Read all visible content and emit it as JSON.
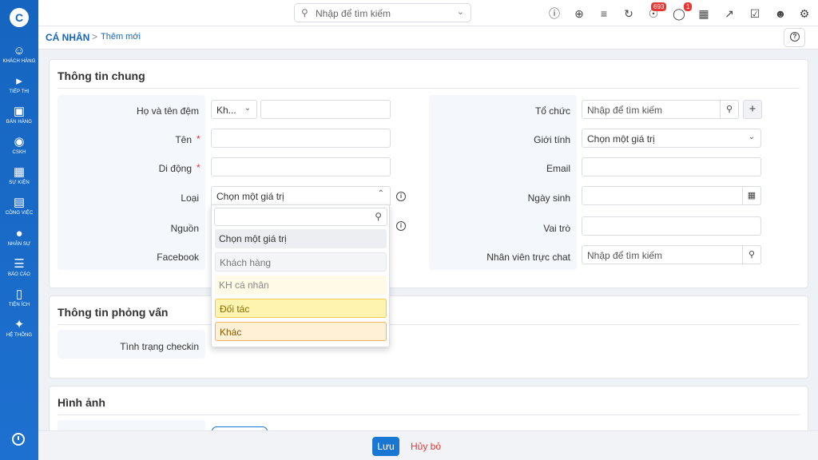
{
  "top": {
    "search_placeholder": "Nhập để tìm kiếm",
    "notif_count": "693",
    "chat_count": "1"
  },
  "sidebar": {
    "items": [
      {
        "label": "KHÁCH HÀNG",
        "icon": "customers-icon"
      },
      {
        "label": "TIẾP THỊ",
        "icon": "megaphone-icon"
      },
      {
        "label": "BÁN HÀNG",
        "icon": "cart-icon"
      },
      {
        "label": "CSKH",
        "icon": "lifebuoy-icon"
      },
      {
        "label": "SỰ KIỆN",
        "icon": "calendar-icon"
      },
      {
        "label": "CÔNG VIỆC",
        "icon": "briefcase-icon"
      },
      {
        "label": "NHÂN SỰ",
        "icon": "person-icon"
      },
      {
        "label": "BÁO CÁO",
        "icon": "report-icon"
      },
      {
        "label": "TIỆN ÍCH",
        "icon": "utilities-icon"
      },
      {
        "label": "HỆ THỐNG",
        "icon": "wrench-icon"
      }
    ]
  },
  "breadcrumb": {
    "root": "CÁ NHÂN",
    "separator": ">",
    "current": "Thêm mới"
  },
  "general": {
    "title": "Thông tin chung",
    "fullname_label": "Họ và tên đệm",
    "title_select": "Kh...",
    "name_label": "Tên",
    "mobile_label": "Di động",
    "type_label": "Loại",
    "type_value": "Chọn một giá trị",
    "source_label": "Nguồn",
    "facebook_label": "Facebook",
    "org_label": "Tổ chức",
    "org_placeholder": "Nhập để tìm kiếm",
    "gender_label": "Giới tính",
    "gender_value": "Chọn một giá trị",
    "email_label": "Email",
    "birthday_label": "Ngày sinh",
    "role_label": "Vai trò",
    "staff_label": "Nhân viên trực chat",
    "staff_placeholder": "Nhập để tìm kiếm",
    "required_mark": "*"
  },
  "dropdown": {
    "options": [
      "Chọn một giá trị",
      "Khách hàng",
      "KH cá nhân",
      "Đối tác",
      "Khác"
    ]
  },
  "interview": {
    "title": "Thông tin phỏng vấn",
    "checkin_label": "Tình trạng checkin"
  },
  "images": {
    "title": "Hình ảnh"
  },
  "footer": {
    "save": "Lưu",
    "cancel": "Hủy bỏ"
  },
  "colors": {
    "primary": "#1565c0",
    "danger": "#e53935",
    "highlight_yellow": "#fff3b0",
    "highlight_orange": "#fff0d6"
  }
}
